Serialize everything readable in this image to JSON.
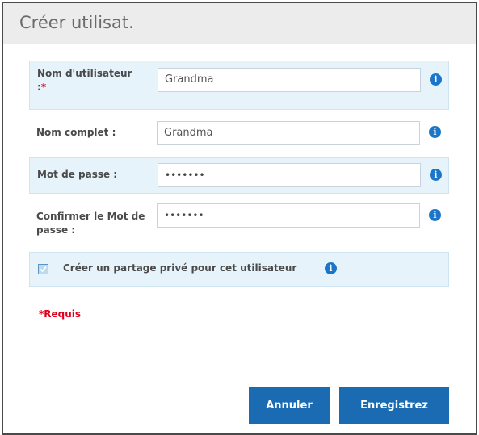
{
  "dialog": {
    "title": "Créer utilisat."
  },
  "form": {
    "username": {
      "label": "Nom d'utilisateur :",
      "required_mark": "*",
      "value": "Grandma"
    },
    "fullname": {
      "label": "Nom complet :",
      "value": "Grandma"
    },
    "password": {
      "label": "Mot de passe :",
      "value": "•••••••"
    },
    "confirm_password": {
      "label": "Confirmer le Mot de passe :",
      "value": "•••••••"
    },
    "private_share": {
      "label": "Créer un partage privé pour cet utilisateur",
      "checked": true
    }
  },
  "required_note": "*Requis",
  "buttons": {
    "cancel": "Annuler",
    "save": "Enregistrez"
  },
  "icons": {
    "info": "info-icon",
    "checkbox": "checkmark-icon"
  },
  "colors": {
    "accent": "#1a6bb1",
    "required": "#e0001b",
    "row_highlight": "#e6f3fb"
  }
}
